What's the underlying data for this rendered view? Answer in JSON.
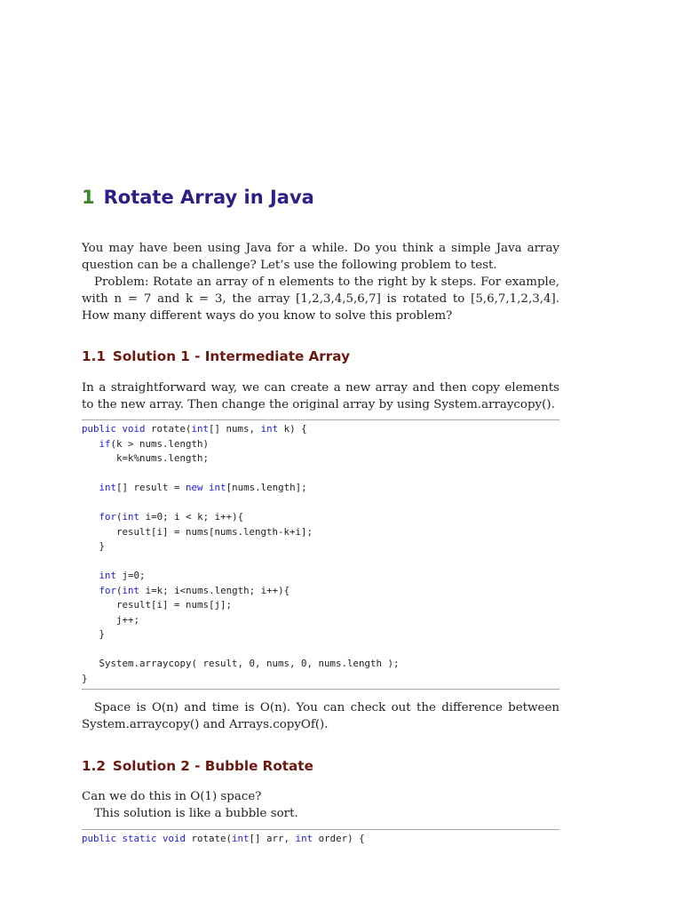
{
  "chapter": {
    "number": "1",
    "title": "Rotate Array in Java"
  },
  "intro": {
    "p1": "You may have been using Java for a while. Do you think a simple Java array question can be a challenge? Let’s use the following problem to test.",
    "p2": "Problem: Rotate an array of n elements to the right by k steps. For example, with n = 7 and k = 3, the array [1,2,3,4,5,6,7] is rotated to [5,6,7,1,2,3,4]. How many different ways do you know to solve this problem?"
  },
  "section1": {
    "number": "1.1",
    "title": "Solution 1 - Intermediate Array",
    "p1": "In a straightforward way, we can create a new array and then copy elements to the new array. Then change the original array by using System.arraycopy().",
    "code": [
      [
        {
          "t": "public void ",
          "k": 1
        },
        {
          "t": "rotate("
        },
        {
          "t": "int",
          "k": 1
        },
        {
          "t": "[] nums, "
        },
        {
          "t": "int",
          "k": 1
        },
        {
          "t": " k) {"
        }
      ],
      [
        {
          "t": "   "
        },
        {
          "t": "if",
          "k": 1
        },
        {
          "t": "(k > nums.length)"
        }
      ],
      [
        {
          "t": "      k=k%nums.length;"
        }
      ],
      [
        {
          "t": ""
        }
      ],
      [
        {
          "t": "   "
        },
        {
          "t": "int",
          "k": 1
        },
        {
          "t": "[] result = "
        },
        {
          "t": "new int",
          "k": 1
        },
        {
          "t": "[nums.length];"
        }
      ],
      [
        {
          "t": ""
        }
      ],
      [
        {
          "t": "   "
        },
        {
          "t": "for",
          "k": 1
        },
        {
          "t": "("
        },
        {
          "t": "int",
          "k": 1
        },
        {
          "t": " i=0; i < k; i++){"
        }
      ],
      [
        {
          "t": "      result[i] = nums[nums.length-k+i];"
        }
      ],
      [
        {
          "t": "   }"
        }
      ],
      [
        {
          "t": ""
        }
      ],
      [
        {
          "t": "   "
        },
        {
          "t": "int",
          "k": 1
        },
        {
          "t": " j=0;"
        }
      ],
      [
        {
          "t": "   "
        },
        {
          "t": "for",
          "k": 1
        },
        {
          "t": "("
        },
        {
          "t": "int",
          "k": 1
        },
        {
          "t": " i=k; i<nums.length; i++){"
        }
      ],
      [
        {
          "t": "      result[i] = nums[j];"
        }
      ],
      [
        {
          "t": "      j++;"
        }
      ],
      [
        {
          "t": "   }"
        }
      ],
      [
        {
          "t": ""
        }
      ],
      [
        {
          "t": "   System.arraycopy( result, 0, nums, 0, nums.length );"
        }
      ],
      [
        {
          "t": "}"
        }
      ]
    ],
    "p2": "Space is O(n) and time is O(n).  You can check out the difference between System.arraycopy() and Arrays.copyOf()."
  },
  "section2": {
    "number": "1.2",
    "title": "Solution 2 - Bubble Rotate",
    "p1": "Can we do this in O(1) space?",
    "p2": "This solution is like a bubble sort.",
    "code": [
      [
        {
          "t": "public static void ",
          "k": 1
        },
        {
          "t": "rotate("
        },
        {
          "t": "int",
          "k": 1
        },
        {
          "t": "[] arr, "
        },
        {
          "t": "int",
          "k": 1
        },
        {
          "t": " order) {"
        }
      ]
    ]
  }
}
